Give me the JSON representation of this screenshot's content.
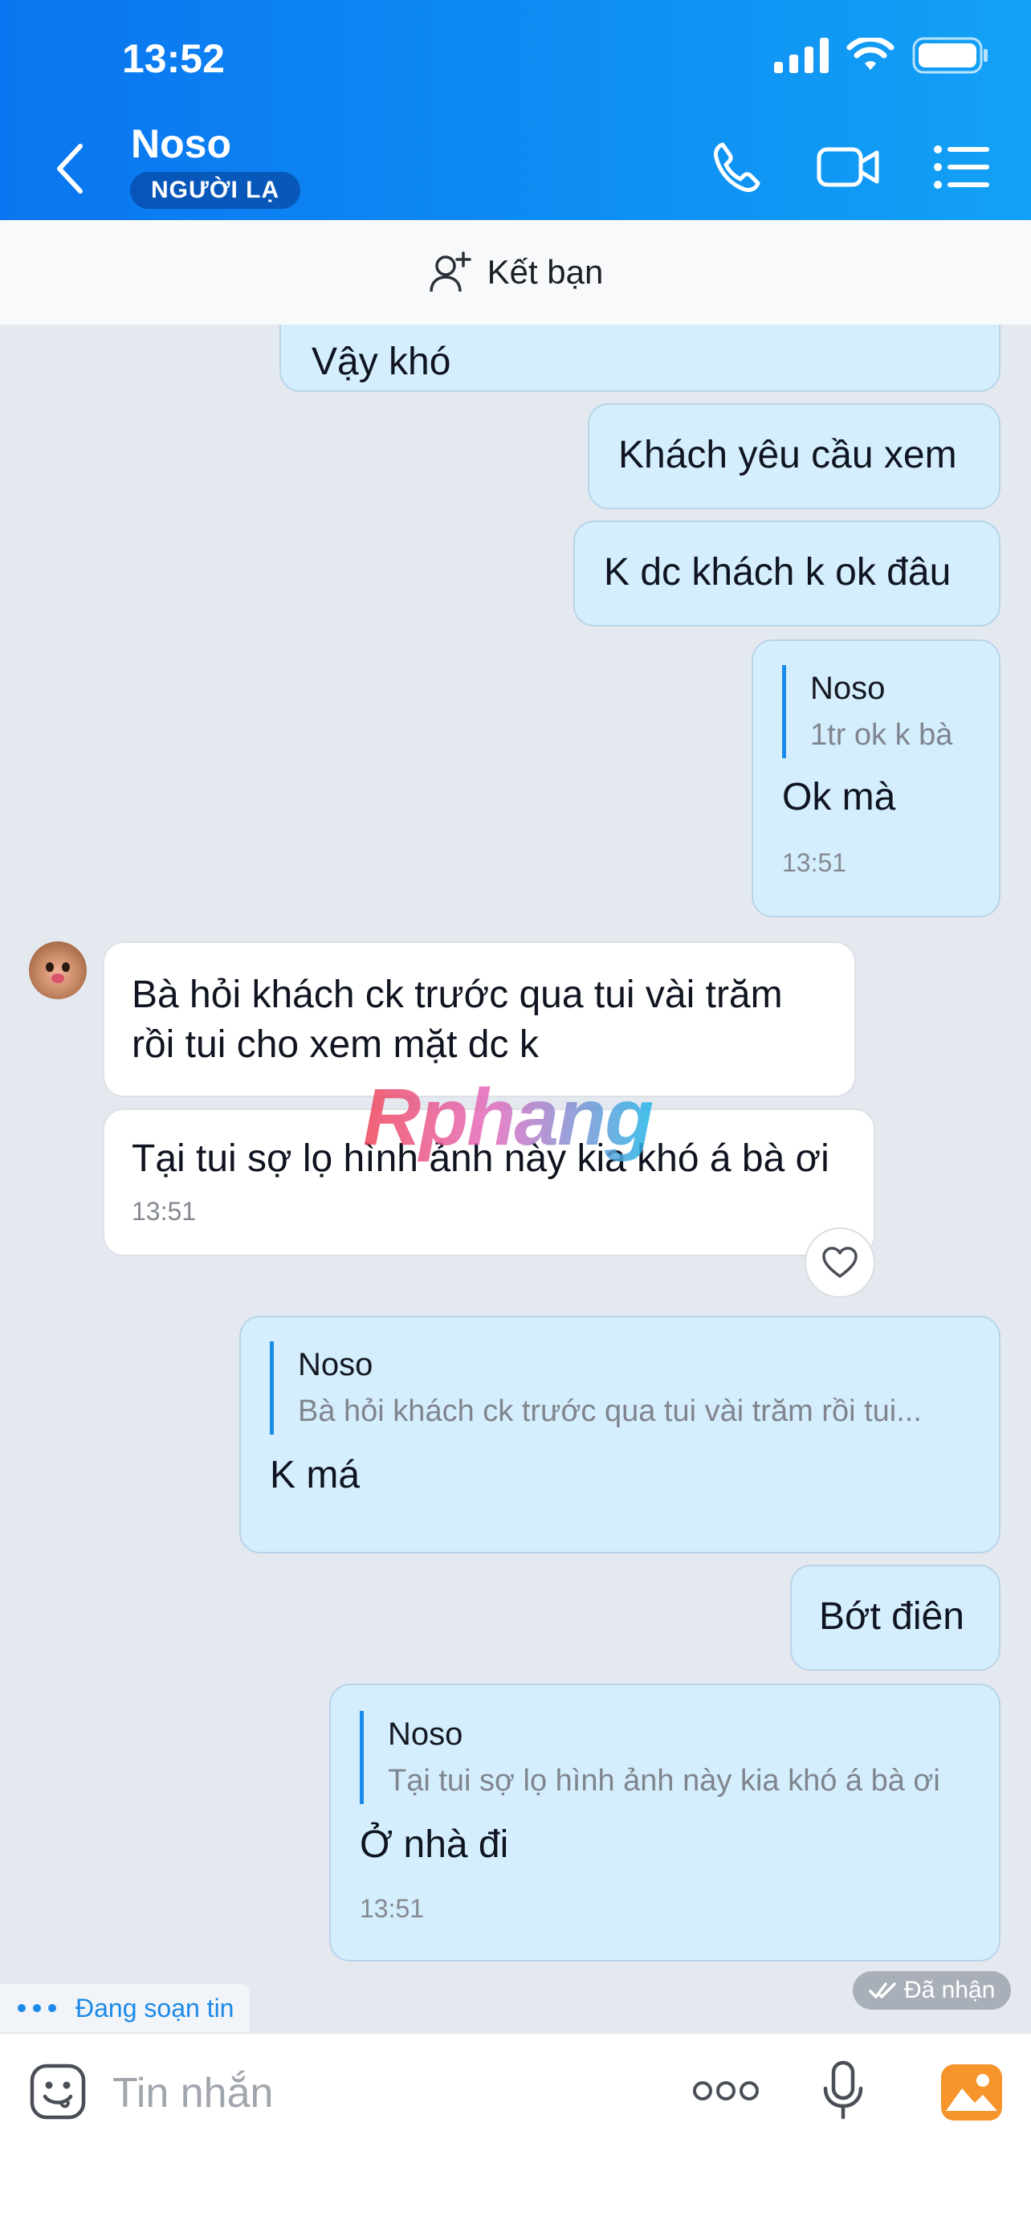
{
  "status_bar": {
    "time": "13:52"
  },
  "header": {
    "contact_name": "Noso",
    "badge": "NGƯỜI LẠ",
    "friend_action": "Kết bạn",
    "icons": [
      "back-icon",
      "phone-icon",
      "video-call-icon",
      "menu-icon"
    ]
  },
  "messages": {
    "m0": {
      "text": "Vậy khó"
    },
    "m1": {
      "text": "Khách yêu cầu xem"
    },
    "m2": {
      "text": "K dc khách k ok đâu"
    },
    "m3": {
      "quote_name": "Noso",
      "quote_text": "1tr ok k bà",
      "text": "Ok mà",
      "time": "13:51"
    },
    "m4": {
      "text": "Bà hỏi khách ck trước qua tui vài trăm rồi tui cho xem mặt dc k"
    },
    "m5": {
      "text": "Tại tui sợ lọ hình ảnh này kia khó á bà ơi",
      "time": "13:51"
    },
    "m6": {
      "quote_name": "Noso",
      "quote_text": "Bà hỏi khách ck trước qua tui vài trăm rồi tui...",
      "text": "K má"
    },
    "m7": {
      "text": "Bớt điên"
    },
    "m8": {
      "quote_name": "Noso",
      "quote_text": "Tại tui sợ lọ hình ảnh này kia khó á bà ơi",
      "text": "Ở nhà đi",
      "time": "13:51"
    }
  },
  "watermark": "Rphang",
  "delivery_status": "Đã nhận",
  "typing_indicator": "Đang soạn tin",
  "input": {
    "placeholder": "Tin nhắn"
  },
  "colors": {
    "header_start": "#0a75f0",
    "header_end": "#12a1f5",
    "outgoing_bubble": "#d4eefd",
    "incoming_bubble": "#ffffff",
    "accent": "#1c8ae8",
    "background": "#e4e8ef"
  }
}
